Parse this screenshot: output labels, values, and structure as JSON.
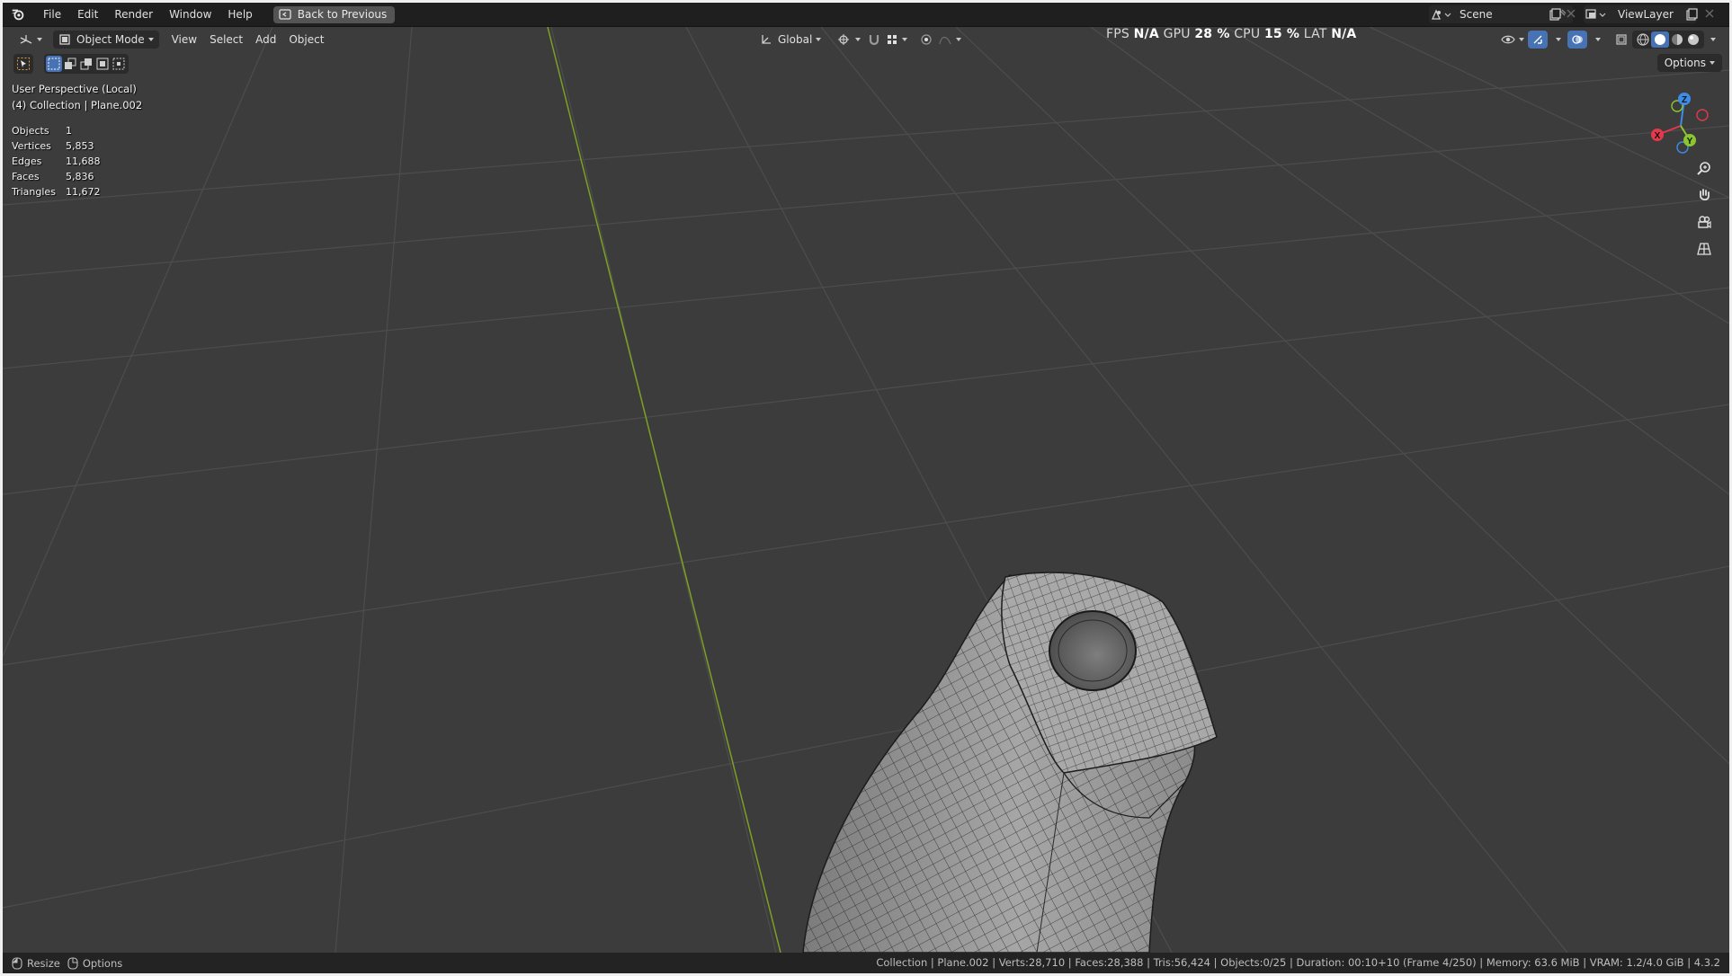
{
  "menubar": {
    "items": [
      "File",
      "Edit",
      "Render",
      "Window",
      "Help"
    ],
    "back_button": "Back to Previous",
    "scene": "Scene",
    "view_layer": "ViewLayer"
  },
  "header": {
    "mode": "Object Mode",
    "menus": [
      "View",
      "Select",
      "Add",
      "Object"
    ],
    "transform_orientation": "Global",
    "options": "Options"
  },
  "performance": {
    "fps_label": "FPS",
    "fps_value": "N/A",
    "gpu_label": "GPU",
    "gpu_value": "28 %",
    "cpu_label": "CPU",
    "cpu_value": "15 %",
    "lat_label": "LAT",
    "lat_value": "N/A"
  },
  "viewport": {
    "perspective": "User Perspective (Local)",
    "collection": "(4) Collection | Plane.002",
    "stats": [
      {
        "label": "Objects",
        "value": "1"
      },
      {
        "label": "Vertices",
        "value": "5,853"
      },
      {
        "label": "Edges",
        "value": "11,688"
      },
      {
        "label": "Faces",
        "value": "5,836"
      },
      {
        "label": "Triangles",
        "value": "11,672"
      }
    ],
    "gizmo": {
      "x": "X",
      "y": "Y",
      "z": "Z"
    }
  },
  "statusbar": {
    "left": [
      {
        "label": "Resize",
        "icon": "mouse-left-icon"
      },
      {
        "label": "Options",
        "icon": "mouse-right-icon"
      }
    ],
    "right": "Collection | Plane.002 | Verts:28,710 | Faces:28,388 | Tris:56,424 | Objects:0/25 | Duration: 00:10+10 (Frame 4/250) | Memory: 63.6 MiB | VRAM: 1.2/4.0 GiB | 4.3.2"
  },
  "colors": {
    "background": "#3c3c3c",
    "grid_line": "#4d4d4d",
    "y_axis": "#7ca024",
    "accent_blue": "#4772b3",
    "gizmo_x": "#e4384d",
    "gizmo_y": "#8bc62f",
    "gizmo_z": "#3c8ce8"
  }
}
